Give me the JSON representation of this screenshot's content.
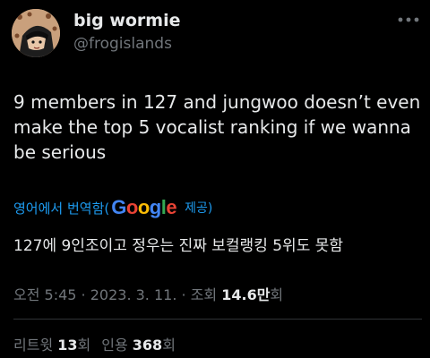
{
  "user": {
    "display_name": "big wormie",
    "handle": "@frogislands"
  },
  "tweet": {
    "text_lines": [
      "9 members in 127 and jungwoo doesn’t even",
      "make the top 5 vocalist ranking if we wanna",
      "be serious"
    ]
  },
  "translation": {
    "label": "영어에서 번역함(",
    "google_letters": [
      {
        "char": "G",
        "color": "#4285f4"
      },
      {
        "char": "o",
        "color": "#ea4335"
      },
      {
        "char": "o",
        "color": "#fbbc05"
      },
      {
        "char": "g",
        "color": "#4285f4"
      },
      {
        "char": "l",
        "color": "#34a853"
      },
      {
        "char": "e",
        "color": "#ea4335"
      }
    ],
    "provider_suffix": "제공)",
    "translated_text": "127에 9인조이고 정우는 진짜 보컬랭킹 5위도 못함"
  },
  "meta": {
    "time": "오전 5:45",
    "sep1": " · ",
    "date": "2023. 3. 11.",
    "sep2": " · ",
    "views_label": "조회 ",
    "views_value": "14.6만",
    "views_unit": "회"
  },
  "stats": {
    "retweets_label": "리트윗 ",
    "retweets_value": "13",
    "retweets_unit": "회",
    "quotes_label": "인용 ",
    "quotes_value": "368",
    "quotes_unit": "회"
  },
  "colors": {
    "background": "#000000",
    "primary_text": "#e7e9ea",
    "secondary_text": "#71767b",
    "link": "#1d9bf0",
    "divider": "#2f3336"
  },
  "icons": {
    "avatar": "avatar-cartoon",
    "more": "more-options-icon"
  }
}
